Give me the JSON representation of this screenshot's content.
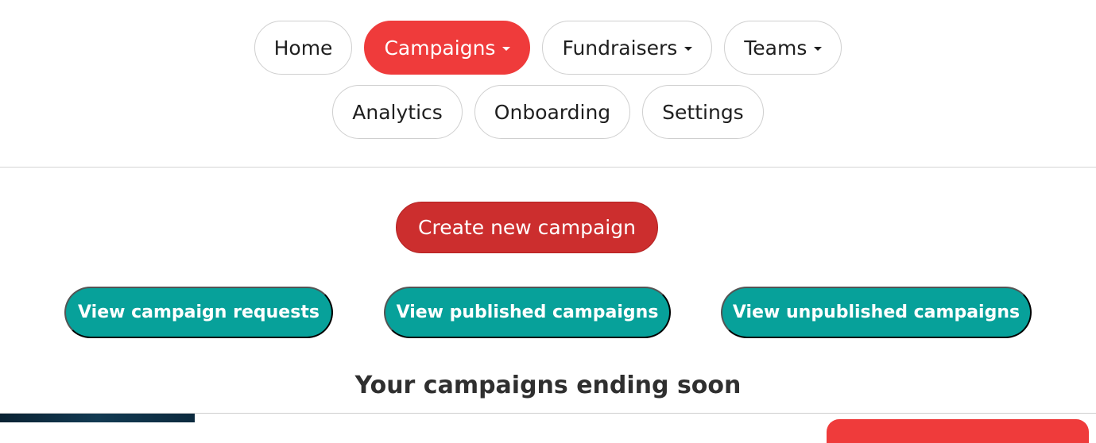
{
  "nav": {
    "row1": [
      {
        "label": "Home",
        "dropdown": false,
        "active": false
      },
      {
        "label": "Campaigns",
        "dropdown": true,
        "active": true
      },
      {
        "label": "Fundraisers",
        "dropdown": true,
        "active": false
      },
      {
        "label": "Teams",
        "dropdown": true,
        "active": false
      }
    ],
    "row2": [
      {
        "label": "Analytics",
        "dropdown": false,
        "active": false
      },
      {
        "label": "Onboarding",
        "dropdown": false,
        "active": false
      },
      {
        "label": "Settings",
        "dropdown": false,
        "active": false
      }
    ]
  },
  "actions": {
    "create_label": "Create new campaign",
    "view_requests_label": "View campaign requests",
    "view_published_label": "View published campaigns",
    "view_unpublished_label": "View unpublished campaigns"
  },
  "section": {
    "title": "Your campaigns ending soon"
  },
  "colors": {
    "active_nav": "#ef3b3b",
    "create_button": "#cc2e2e",
    "teal_button": "#07a19a",
    "text": "#1f1f1f"
  },
  "icons": {
    "dropdown": "caret-down-icon"
  }
}
